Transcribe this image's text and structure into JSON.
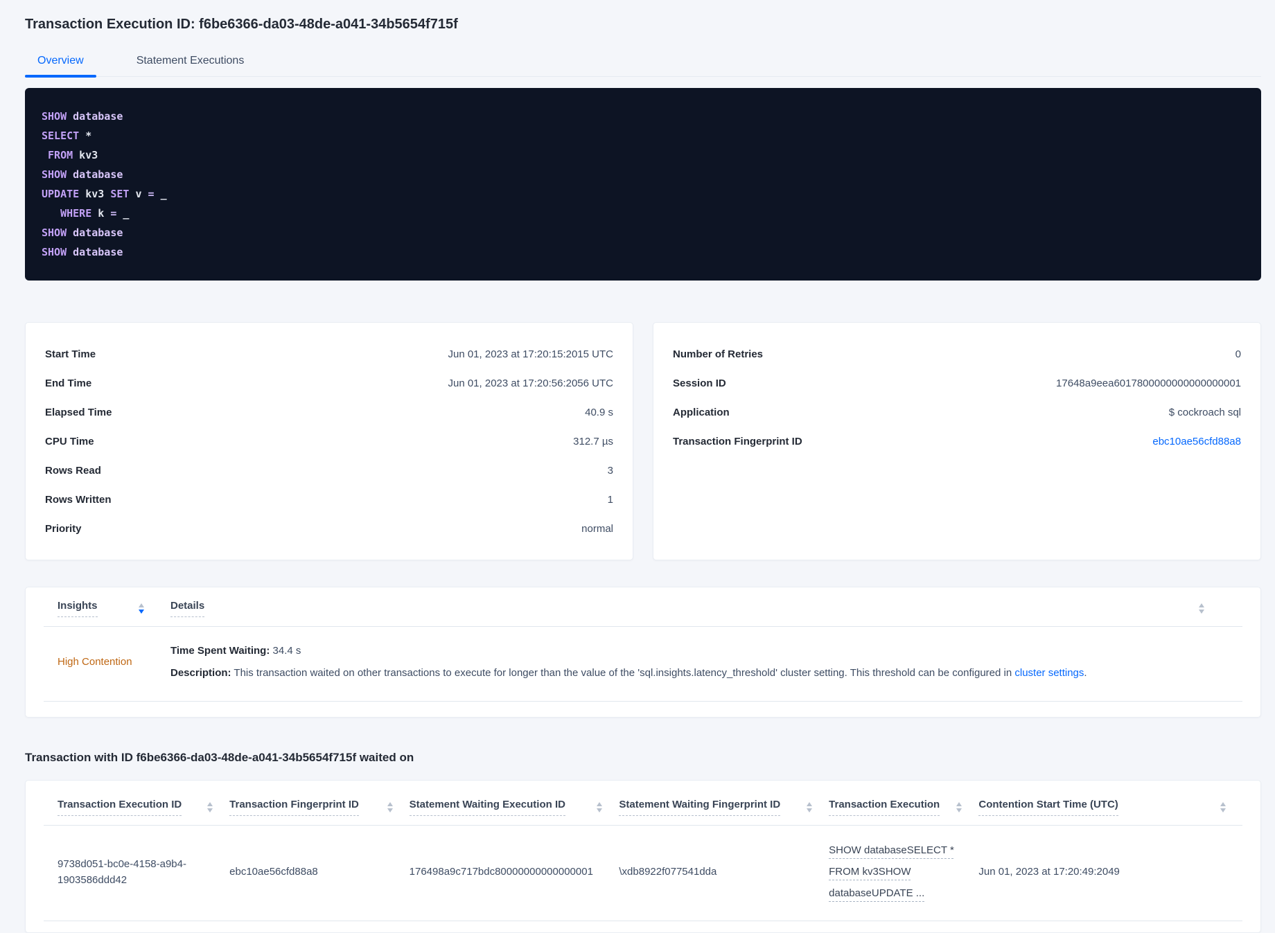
{
  "page_title": "Transaction Execution ID: f6be6366-da03-48de-a041-34b5654f715f",
  "tabs": {
    "overview": "Overview",
    "statement_executions": "Statement Executions"
  },
  "colors": {
    "accent_blue": "#0568fd",
    "high_contention_orange": "#bf6713",
    "code_background": "#0d1424",
    "code_keyword": "#c2a1f6",
    "code_text": "#e3e7ef"
  },
  "sql_box": {
    "lines": [
      [
        [
          "kw",
          "SHOW"
        ],
        [
          "pl",
          " "
        ],
        [
          "kw2",
          "database"
        ]
      ],
      [
        [
          "kw",
          "SELECT"
        ],
        [
          "pl",
          " *"
        ]
      ],
      [
        [
          "pl",
          " "
        ],
        [
          "kw",
          "FROM"
        ],
        [
          "pl",
          " kv3"
        ]
      ],
      [
        [
          "kw",
          "SHOW"
        ],
        [
          "pl",
          " "
        ],
        [
          "kw2",
          "database"
        ]
      ],
      [
        [
          "kw",
          "UPDATE"
        ],
        [
          "pl",
          " kv3 "
        ],
        [
          "kw",
          "SET"
        ],
        [
          "pl",
          " v "
        ],
        [
          "op",
          "="
        ],
        [
          "pl",
          " _"
        ]
      ],
      [
        [
          "pl",
          "   "
        ],
        [
          "kw",
          "WHERE"
        ],
        [
          "pl",
          " k "
        ],
        [
          "op",
          "="
        ],
        [
          "pl",
          " _"
        ]
      ],
      [
        [
          "kw",
          "SHOW"
        ],
        [
          "pl",
          " "
        ],
        [
          "kw2",
          "database"
        ]
      ],
      [
        [
          "kw",
          "SHOW"
        ],
        [
          "pl",
          " "
        ],
        [
          "kw2",
          "database"
        ]
      ]
    ]
  },
  "details_left": {
    "rows": [
      {
        "label": "Start Time",
        "value": "Jun 01, 2023 at 17:20:15:2015 UTC"
      },
      {
        "label": "End Time",
        "value": "Jun 01, 2023 at 17:20:56:2056 UTC"
      },
      {
        "label": "Elapsed Time",
        "value": "40.9 s"
      },
      {
        "label": "CPU Time",
        "value": "312.7 µs"
      },
      {
        "label": "Rows Read",
        "value": "3"
      },
      {
        "label": "Rows Written",
        "value": "1"
      },
      {
        "label": "Priority",
        "value": "normal"
      }
    ]
  },
  "details_right": {
    "rows": [
      {
        "label": "Number of Retries",
        "value": "0"
      },
      {
        "label": "Session ID",
        "value": "17648a9eea6017800000000000000001"
      },
      {
        "label": "Application",
        "value": "$ cockroach sql"
      },
      {
        "label": "Transaction Fingerprint ID",
        "value": "ebc10ae56cfd88a8",
        "link": true
      }
    ]
  },
  "insights": {
    "col_insights": "Insights",
    "col_details": "Details",
    "row": {
      "insight": "High Contention",
      "waiting_label": "Time Spent Waiting:",
      "waiting_value": " 34.4 s",
      "description_label": "Description:",
      "description_text": " This transaction waited on other transactions to execute for longer than the value of the 'sql.insights.latency_threshold' cluster setting. This threshold can be configured in ",
      "description_link": "cluster settings",
      "description_suffix": "."
    }
  },
  "waited_on": {
    "heading": "Transaction with ID f6be6366-da03-48de-a041-34b5654f715f waited on",
    "columns": [
      "Transaction Execution ID",
      "Transaction Fingerprint ID",
      "Statement Waiting Execution ID",
      "Statement Waiting Fingerprint ID",
      "Transaction Execution",
      "Contention Start Time (UTC)"
    ],
    "column_widths": [
      "15.5%",
      "15%",
      "17.5%",
      "17.5%",
      "12.5%",
      "22%"
    ],
    "link_cell_index": 4,
    "rows": [
      [
        "9738d051-bc0e-4158-a9b4-1903586ddd42",
        "ebc10ae56cfd88a8",
        "176498a9c717bdc80000000000000001",
        "\\xdb8922f077541dda",
        "SHOW databaseSELECT * FROM kv3SHOW databaseUPDATE ...",
        "Jun 01, 2023 at 17:20:49:2049"
      ]
    ]
  }
}
